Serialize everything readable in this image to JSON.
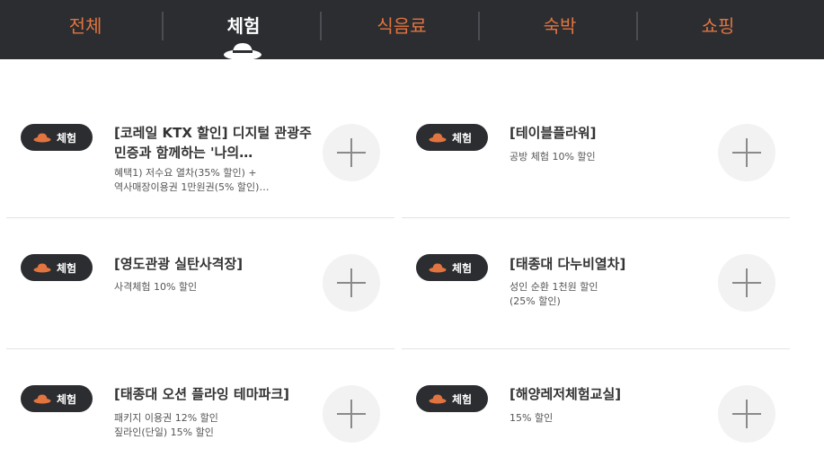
{
  "tabs": [
    {
      "label": "전체",
      "active": false
    },
    {
      "label": "체험",
      "active": true
    },
    {
      "label": "식음료",
      "active": false
    },
    {
      "label": "숙박",
      "active": false
    },
    {
      "label": "쇼핑",
      "active": false
    }
  ],
  "colors": {
    "accent": "#e2743f",
    "dark": "#2b2d31",
    "plus_bg": "#f2f2f2"
  },
  "items": [
    {
      "badge": "체험",
      "badge_icon": "hat-icon",
      "title": "[코레일 KTX 할인] 디지털 관광주민증과 함께하는 '나의…",
      "desc_lines": [
        "혜택1) 저수요 열차(35% 할인) +",
        "역사매장이용권 1만원권(5% 할인)…"
      ]
    },
    {
      "badge": "체험",
      "badge_icon": "hat-icon",
      "title": "[테이블플라워]",
      "desc_lines": [
        "공방 체험 10% 할인"
      ]
    },
    {
      "badge": "체험",
      "badge_icon": "hat-icon",
      "title": "[영도관광 실탄사격장]",
      "desc_lines": [
        "사격체험 10% 할인"
      ]
    },
    {
      "badge": "체험",
      "badge_icon": "hat-icon",
      "title": "[태종대 다누비열차]",
      "desc_lines": [
        "성인 순환 1천원 할인",
        "(25% 할인)"
      ]
    },
    {
      "badge": "체험",
      "badge_icon": "hat-icon",
      "title": "[태종대 오션 플라잉 테마파크]",
      "desc_lines": [
        "패키지 이용권 12% 할인",
        "짚라인(단일) 15% 할인"
      ]
    },
    {
      "badge": "체험",
      "badge_icon": "hat-icon",
      "title": "[해양레저체험교실]",
      "desc_lines": [
        "15% 할인"
      ]
    }
  ]
}
